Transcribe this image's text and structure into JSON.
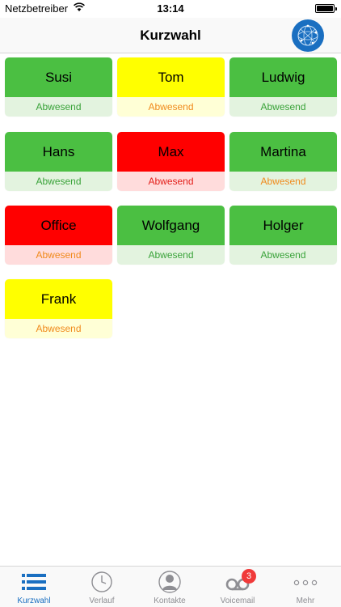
{
  "status_bar": {
    "carrier": "Netzbetreiber",
    "time": "13:14"
  },
  "header": {
    "title": "Kurzwahl",
    "avatar_icon": "globe-network-icon"
  },
  "colors": {
    "green": "#4bbf42",
    "green_light": "#e3f3df",
    "yellow": "#ffff00",
    "yellow_light": "#ffffd6",
    "red": "#ff0000",
    "red_light": "#ffdcdc",
    "status_green": "#3aa33a",
    "status_orange": "#f08a1c",
    "status_red": "#e3201b"
  },
  "contacts": [
    {
      "name": "Susi",
      "status": "Abwesend",
      "color": "green",
      "status_color": "status_green"
    },
    {
      "name": "Tom",
      "status": "Abwesend",
      "color": "yellow",
      "status_color": "status_orange"
    },
    {
      "name": "Ludwig",
      "status": "Abwesend",
      "color": "green",
      "status_color": "status_green"
    },
    {
      "name": "Hans",
      "status": "Abwesend",
      "color": "green",
      "status_color": "status_green"
    },
    {
      "name": "Max",
      "status": "Abwesend",
      "color": "red",
      "status_color": "status_red"
    },
    {
      "name": "Martina",
      "status": "Abwesend",
      "color": "green",
      "status_color": "status_orange"
    },
    {
      "name": "Office",
      "status": "Abwesend",
      "color": "red",
      "status_color": "status_orange"
    },
    {
      "name": "Wolfgang",
      "status": "Abwesend",
      "color": "green",
      "status_color": "status_green"
    },
    {
      "name": "Holger",
      "status": "Abwesend",
      "color": "green",
      "status_color": "status_green"
    },
    {
      "name": "Frank",
      "status": "Abwesend",
      "color": "yellow",
      "status_color": "status_orange"
    }
  ],
  "tabs": [
    {
      "label": "Kurzwahl",
      "icon": "list-icon",
      "active": true
    },
    {
      "label": "Verlauf",
      "icon": "clock-icon",
      "active": false
    },
    {
      "label": "Kontakte",
      "icon": "person-icon",
      "active": false
    },
    {
      "label": "Voicemail",
      "icon": "voicemail-icon",
      "active": false,
      "badge": "3"
    },
    {
      "label": "Mehr",
      "icon": "more-icon",
      "active": false
    }
  ]
}
